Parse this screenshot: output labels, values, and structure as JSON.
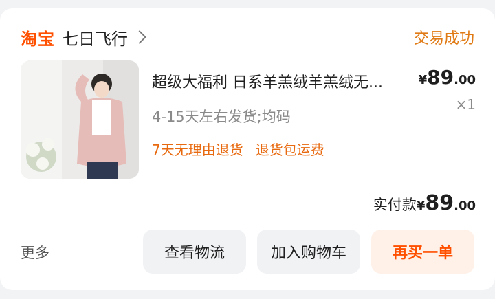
{
  "shop": {
    "logo_text": "淘宝",
    "name": "七日飞行",
    "status": "交易成功"
  },
  "product": {
    "title": "超级大福利 日系羊羔绒羊羔绒无...",
    "price_yen": "¥",
    "price_int": "89",
    "price_dec": ".00",
    "quantity": "×1",
    "spec": "4-15天左右发货;均码",
    "services": [
      "7天无理由退货",
      "退货包运费"
    ]
  },
  "payment": {
    "label": "实付款",
    "yen": "¥",
    "int": "89",
    "dec": ".00"
  },
  "actions": {
    "more": "更多",
    "logistics": "查看物流",
    "add_cart": "加入购物车",
    "rebuy": "再买一单"
  },
  "colors": {
    "brand": "#ff5000",
    "status": "#e07a14",
    "service": "#e86a10"
  }
}
